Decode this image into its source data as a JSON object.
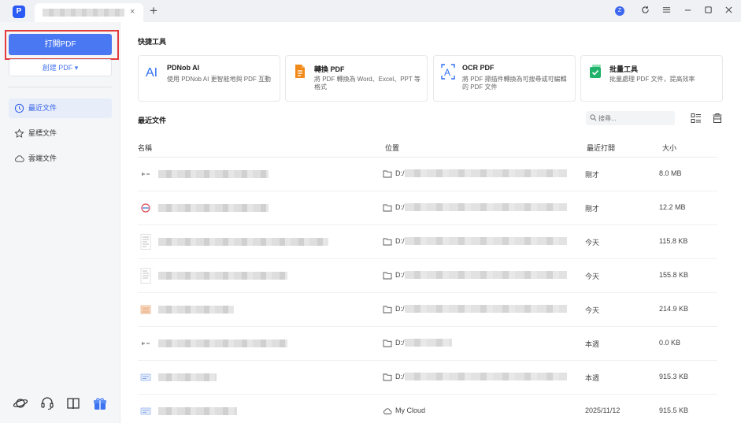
{
  "titlebar": {
    "logo_glyph": "P",
    "tab_close": "×",
    "tab_add": "+",
    "avatar_letter": "Z",
    "icons": [
      "refresh-icon",
      "menu-icon",
      "minimize-icon",
      "maximize-icon",
      "close-icon"
    ]
  },
  "sidebar": {
    "open_pdf": "打開PDF",
    "create_pdf": "創建 PDF ▾",
    "nav": [
      {
        "label": "最近文件",
        "icon": "clock-icon",
        "active": true
      },
      {
        "label": "星標文件",
        "icon": "star-icon",
        "active": false
      },
      {
        "label": "雲端文件",
        "icon": "cloud-icon",
        "active": false
      }
    ],
    "bottom_icons": [
      "planet-icon",
      "headset-icon",
      "book-icon",
      "gift-icon"
    ]
  },
  "quick_tools": {
    "title": "快捷工具",
    "cards": [
      {
        "name": "PDNob AI",
        "desc": "使用 PDNob AI 更智能地與 PDF 互動",
        "icon": "ai-icon",
        "color": "#2f6ff0"
      },
      {
        "name": "轉換 PDF",
        "desc": "將 PDF 轉換為 Word、Excel、PPT 等格式",
        "icon": "convert-icon",
        "color": "#f28a1a"
      },
      {
        "name": "OCR PDF",
        "desc": "將 PDF 掃描件轉換為可搜尋或可編輯的 PDF 文件",
        "icon": "ocr-icon",
        "color": "#2f6ff0"
      },
      {
        "name": "批量工具",
        "desc": "批量處理 PDF 文件，提高效率",
        "icon": "batch-icon",
        "color": "#21b36b"
      }
    ]
  },
  "recent": {
    "title": "最近文件",
    "search_placeholder": "搜尋...",
    "columns": {
      "name": "名稱",
      "location": "位置",
      "last_opened": "最近打開",
      "size": "大小"
    },
    "rows": [
      {
        "loc_icon": "folder-icon",
        "location": "D:/",
        "time": "剛才",
        "size": "8.0 MB"
      },
      {
        "loc_icon": "folder-icon",
        "location": "D:/",
        "time": "剛才",
        "size": "12.2 MB"
      },
      {
        "loc_icon": "folder-icon",
        "location": "D:/",
        "time": "今天",
        "size": "115.8 KB"
      },
      {
        "loc_icon": "folder-icon",
        "location": "D:/",
        "time": "今天",
        "size": "155.8 KB"
      },
      {
        "loc_icon": "folder-icon",
        "location": "D:/",
        "time": "今天",
        "size": "214.9 KB"
      },
      {
        "loc_icon": "folder-icon",
        "location": "D:/",
        "time": "本週",
        "size": "0.0 KB"
      },
      {
        "loc_icon": "folder-icon",
        "location": "D:/",
        "time": "本週",
        "size": "915.3 KB"
      },
      {
        "loc_icon": "cloud-icon",
        "location": "My Cloud",
        "time": "2025/11/12",
        "size": "915.5 KB"
      }
    ]
  }
}
